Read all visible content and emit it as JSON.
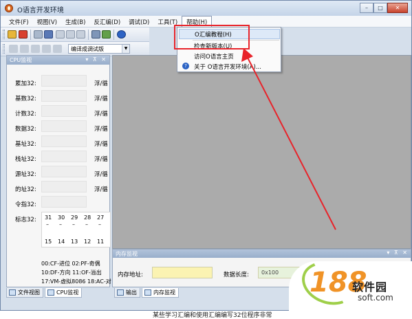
{
  "window": {
    "title": "O语言开发环境",
    "buttons": {
      "minimize": "–",
      "maximize": "□",
      "close": "✕"
    }
  },
  "menubar": {
    "items": [
      {
        "label": "文件(F)"
      },
      {
        "label": "视图(V)"
      },
      {
        "label": "生成(B)"
      },
      {
        "label": "反汇编(D)"
      },
      {
        "label": "调试(D)"
      },
      {
        "label": "工具(T)"
      },
      {
        "label": "帮助(H)"
      }
    ]
  },
  "help_menu": {
    "items": [
      {
        "label": "O汇编教程(H)",
        "highlighted": true
      },
      {
        "label": "检查新版本(U)"
      },
      {
        "label": "访问O语言主页"
      },
      {
        "label": "关于 O语言开发环境(A)..."
      }
    ]
  },
  "toolbar": {
    "build_config": "编译成调试版",
    "icons": [
      "new-icon",
      "open-icon",
      "save-icon",
      "save-all-icon",
      "cut-icon",
      "copy-icon",
      "paste-icon",
      "find-icon",
      "tools-icon",
      "help-icon"
    ],
    "debug_icons": [
      "step-icon",
      "step-over-icon",
      "run-icon",
      "go-icon",
      "break-icon"
    ]
  },
  "cpu_panel": {
    "title": "CPU监视",
    "controls": "▾ ⊼ ✕",
    "registers": [
      {
        "label": "累加32:",
        "right": "浮/循"
      },
      {
        "label": "基数32:",
        "right": "浮/循"
      },
      {
        "label": "计数32:",
        "right": "浮/循"
      },
      {
        "label": "数据32:",
        "right": "浮/循"
      },
      {
        "label": "基址32:",
        "right": "浮/循"
      },
      {
        "label": "栈址32:",
        "right": "浮/循"
      },
      {
        "label": "源址32:",
        "right": "浮/循"
      },
      {
        "label": "的址32:",
        "right": "浮/循"
      },
      {
        "label": "令指32:",
        "right": ""
      }
    ],
    "flags_label": "标志32:",
    "flag_numbers_top": [
      "31",
      "30",
      "29",
      "28",
      "27"
    ],
    "flag_numbers_bottom": [
      "15",
      "14",
      "13",
      "12",
      "11"
    ],
    "flag_values": [
      "–",
      "–",
      "–",
      "–",
      "–"
    ],
    "legend": [
      "00:CF-进位 02:PF-奇偶",
      "10:DF-方向 11:OF-溢出",
      "17:VM-虚拟8086 18:AC-对"
    ]
  },
  "left_tabs": [
    {
      "label": "文件视图",
      "active": false
    },
    {
      "label": "CPU监视",
      "active": true
    }
  ],
  "memory_panel": {
    "title": "内存监视",
    "controls": "▾ ⊼ ✕",
    "address_label": "内存地址:",
    "address_value": "",
    "length_label": "数据长度:",
    "length_value": "0x100"
  },
  "bottom_tabs": [
    {
      "label": "输出",
      "active": false
    },
    {
      "label": "内存监视",
      "active": true
    }
  ],
  "footer_text": "某些学习汇编和使用汇编编写32位程序非常",
  "watermark": {
    "number": "188",
    "name": "软件园",
    "site": "soft.com"
  },
  "colors": {
    "highlight_box": "#e8232a",
    "arrow": "#e8232a",
    "accent": "#98aecb"
  }
}
